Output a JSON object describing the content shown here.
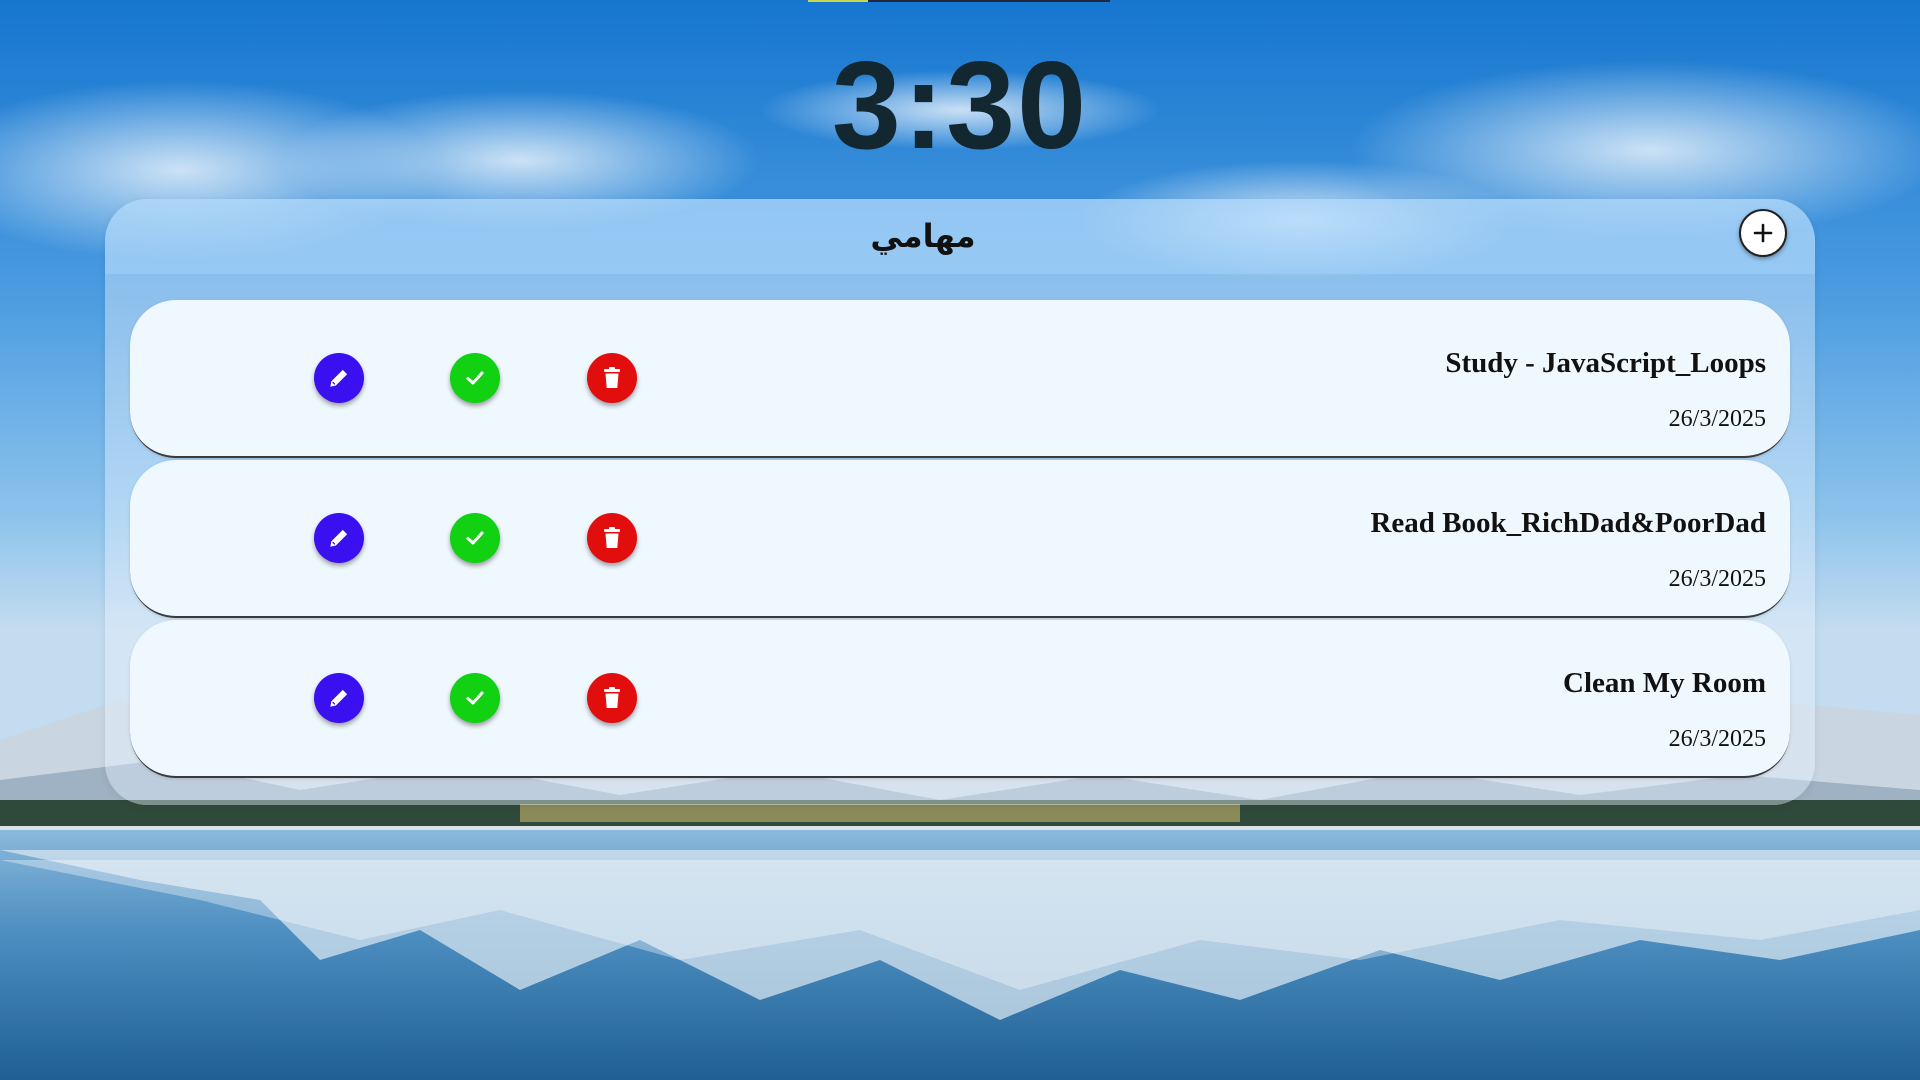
{
  "colors": {
    "edit_button": "#3b10f0",
    "done_button": "#12d012",
    "delete_button": "#e20e0e",
    "clock_text": "#12272f",
    "card_background": "#eff7ff"
  },
  "clock": {
    "time": "3:30"
  },
  "panel": {
    "title": "مهامي",
    "add_icon": "plus-icon"
  },
  "tasks": [
    {
      "title": "Study - JavaScript_Loops",
      "date": "26/3/2025"
    },
    {
      "title": "Read Book_RichDad&PoorDad",
      "date": "26/3/2025"
    },
    {
      "title": "Clean My Room",
      "date": "26/3/2025"
    }
  ],
  "icons": {
    "edit": "pencil-icon",
    "done": "check-icon",
    "delete": "trash-icon"
  }
}
